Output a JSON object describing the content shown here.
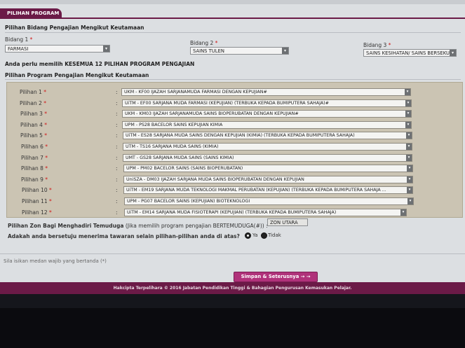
{
  "page_tab": "PILIHAN PROGRAM",
  "bidang_section_title": "Pilihan Bidang Pengajian Mengikut Keutamaan",
  "bidang": [
    {
      "label": "Bidang 1",
      "value": "FARMASI"
    },
    {
      "label": "Bidang 2",
      "value": "SAINS TULEN"
    },
    {
      "label": "Bidang 3",
      "value": "SAINS KESIHATAN/ SAINS BERSEKUTU"
    }
  ],
  "required_mark": "*",
  "notice": "Anda perlu memilih KESEMUA 12 PILIHAN PROGRAM PENGAJIAN",
  "program_section_title": "Pilihan Program Pengajian Mengikut Keutamaan",
  "colon": ":",
  "pilihan": [
    {
      "label": "Pilihan 1",
      "value": "UKM - KF00 IJAZAH SARJANAMUDA FARMASI DENGAN KEPUJIAN#"
    },
    {
      "label": "Pilihan 2",
      "value": "UiTM - EF00 SARJANA MUDA FARMASI (KEPUJIAN) (TERBUKA KEPADA BUMIPUTERA SAHAJA)#"
    },
    {
      "label": "Pilihan 3",
      "value": "UKM - KM03 IJAZAH SARJANAMUDA SAINS BIOPERUBATAN DENGAN KEPUJIAN#"
    },
    {
      "label": "Pilihan 4",
      "value": "UPM - PS28 BACELOR SAINS KEPUJIAN KIMIA"
    },
    {
      "label": "Pilihan 5",
      "value": "UiTM - ES28 SARJANA MUDA SAINS DENGAN KEPUJIAN (KIMIA) (TERBUKA KEPADA BUMIPUTERA SAHAJA)"
    },
    {
      "label": "Pilihan 6",
      "value": "UTM - TS16 SARJANA MUDA SAINS (KIMIA)"
    },
    {
      "label": "Pilihan 7",
      "value": "UMT - GS28 SARJANA MUDA SAINS (SAINS KIMIA)"
    },
    {
      "label": "Pilihan 8",
      "value": "UPM - PM02 BACELOR SAINS (SAINS BIOPERUBATAN)"
    },
    {
      "label": "Pilihan 9",
      "value": "UniSZA - DM03 IJAZAH SARJANA MUDA SAINS BIOPERUBATAN DENGAN KEPUJIAN"
    },
    {
      "label": "Pilihan 10",
      "value": "UiTM - EM19 SARJANA MUDA TEKNOLOGI MAKMAL PERUBATAN (KEPUJIAN) (TERBUKA KEPADA BUMIPUTERA SAHAJA ..."
    },
    {
      "label": "Pilihan 11",
      "value": "UPM - PG07 BACELOR SAINS (KEPUJIAN) BIOTEKNOLOGI"
    },
    {
      "label": "Pilihan 12",
      "value": "UiTM - EM14 SARJANA MUDA FISIOTERAPI (KEPUJIAN) (TERBUKA KEPADA BUMIPUTERA SAHAJA)"
    }
  ],
  "zon_label": "Pilihan Zon Bagi Menghadiri Temuduga",
  "zon_note": "(Jika memilih program pengajian BERTEMUDUGA(#)) :",
  "zon_value": "ZON UTARA",
  "tawaran_question": "Adakah anda bersetuju menerima tawaran selain pilihan-pilihan anda di atas?",
  "radio_ya": "Ya",
  "radio_tidak": "Tidak",
  "required_note": "Sila isikan medan wajib yang bertanda (*)",
  "submit_button": "Simpan & Seterusnya → →",
  "footer": "Hakcipta Terpelihara © 2016 Jabatan Pendidikan Tinggi & Bahagian Pengurusan Kemasukan Pelajar.",
  "colors": {
    "accent": "#6b1a47",
    "button": "#b0327a",
    "required": "#d01515",
    "panel": "#cbc4b3"
  },
  "icons": {
    "dropdown": "dropdown-arrow-icon",
    "radio": "radio-button-icon"
  }
}
